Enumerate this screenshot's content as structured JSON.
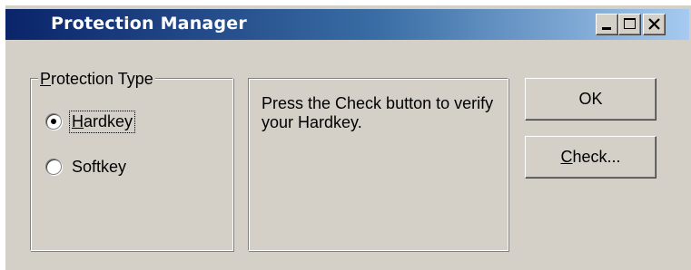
{
  "window": {
    "title": "Protection Manager",
    "controls": [
      "minimize-icon",
      "maximize-icon",
      "close-icon"
    ]
  },
  "protection_type": {
    "legend_mnemonic": "P",
    "legend_rest": "rotection Type",
    "options": [
      {
        "mnemonic": "H",
        "rest": "ardkey",
        "selected": true
      },
      {
        "mnemonic": "",
        "rest": "Softkey",
        "selected": false
      }
    ]
  },
  "message": "Press the Check button to verify your Hardkey.",
  "buttons": {
    "ok_label": "OK",
    "check_mnemonic": "C",
    "check_rest": "heck..."
  },
  "colors": {
    "face": "#d4d0c8",
    "title_start": "#0a246a",
    "title_end": "#a6caf0"
  }
}
